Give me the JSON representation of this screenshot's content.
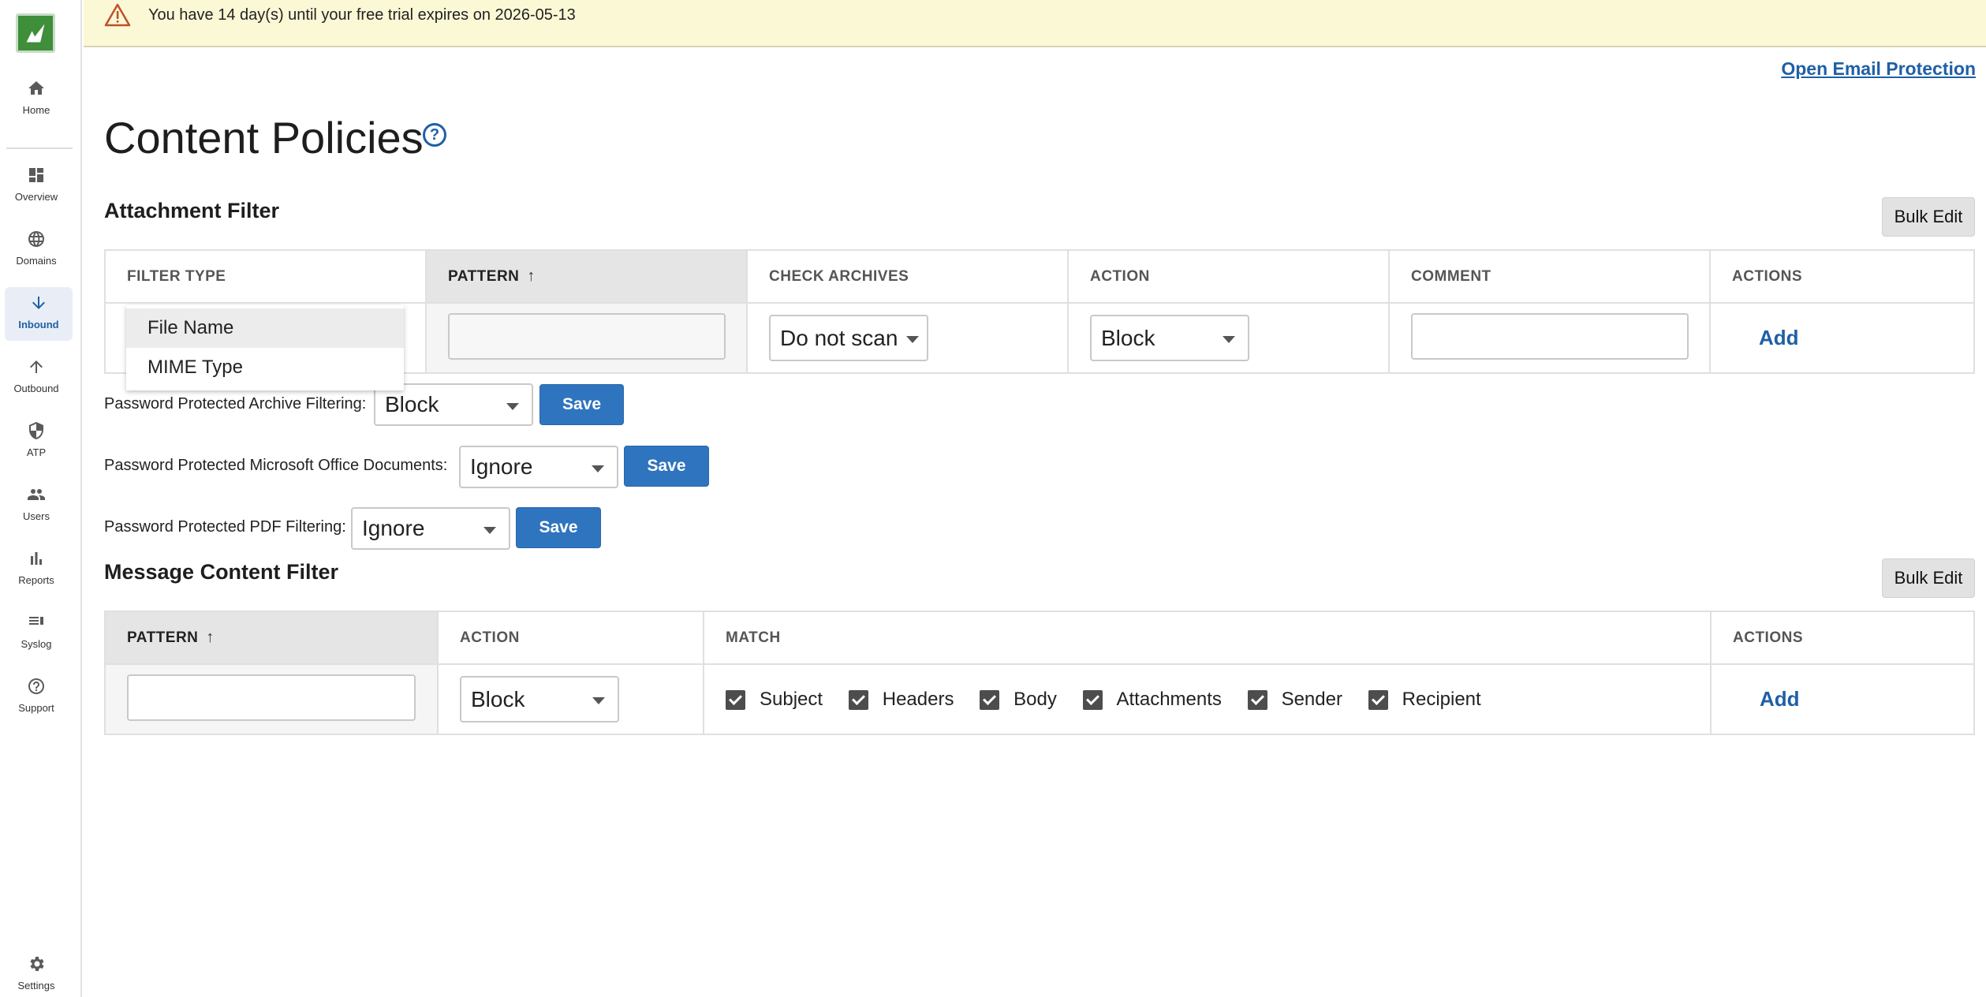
{
  "banner": {
    "text": "You have 14 day(s) until your free trial expires on 2026-05-13"
  },
  "header": {
    "open_link": "Open Email Protection",
    "title": "Content Policies",
    "help_glyph": "?"
  },
  "sidebar": {
    "items": [
      {
        "label": "Home",
        "icon": "home-icon"
      },
      {
        "label": "Overview",
        "icon": "dashboard-icon"
      },
      {
        "label": "Domains",
        "icon": "globe-icon"
      },
      {
        "label": "Inbound",
        "icon": "arrow-down-icon",
        "active": true
      },
      {
        "label": "Outbound",
        "icon": "arrow-up-icon"
      },
      {
        "label": "ATP",
        "icon": "shield-icon"
      },
      {
        "label": "Users",
        "icon": "users-icon"
      },
      {
        "label": "Reports",
        "icon": "bar-chart-icon"
      },
      {
        "label": "Syslog",
        "icon": "list-icon"
      },
      {
        "label": "Support",
        "icon": "help-circle-icon"
      },
      {
        "label": "Settings",
        "icon": "gear-icon"
      }
    ]
  },
  "attachment": {
    "title": "Attachment Filter",
    "bulk_edit": "Bulk Edit",
    "columns": [
      "FILTER TYPE",
      "PATTERN",
      "CHECK ARCHIVES",
      "ACTION",
      "COMMENT",
      "ACTIONS"
    ],
    "sort_glyph": "↑",
    "check_archives_value": "Do not scan",
    "action_value": "Block",
    "add": "Add",
    "dropdown_options": [
      "File Name",
      "MIME Type"
    ]
  },
  "password": {
    "archive_label": "Password Protected Archive Filtering:",
    "archive_value": "Block",
    "office_label": "Password Protected Microsoft Office Documents:",
    "office_value": "Ignore",
    "pdf_label": "Password Protected PDF Filtering:",
    "pdf_value": "Ignore",
    "save": "Save"
  },
  "message": {
    "title": "Message Content Filter",
    "bulk_edit": "Bulk Edit",
    "columns": [
      "PATTERN",
      "ACTION",
      "MATCH",
      "ACTIONS"
    ],
    "sort_glyph": "↑",
    "action_value": "Block",
    "matches": [
      "Subject",
      "Headers",
      "Body",
      "Attachments",
      "Sender",
      "Recipient"
    ],
    "add": "Add"
  },
  "colors": {
    "accent": "#2f74be",
    "brand": "#3e8e3a",
    "banner": "#fbf8d6"
  }
}
